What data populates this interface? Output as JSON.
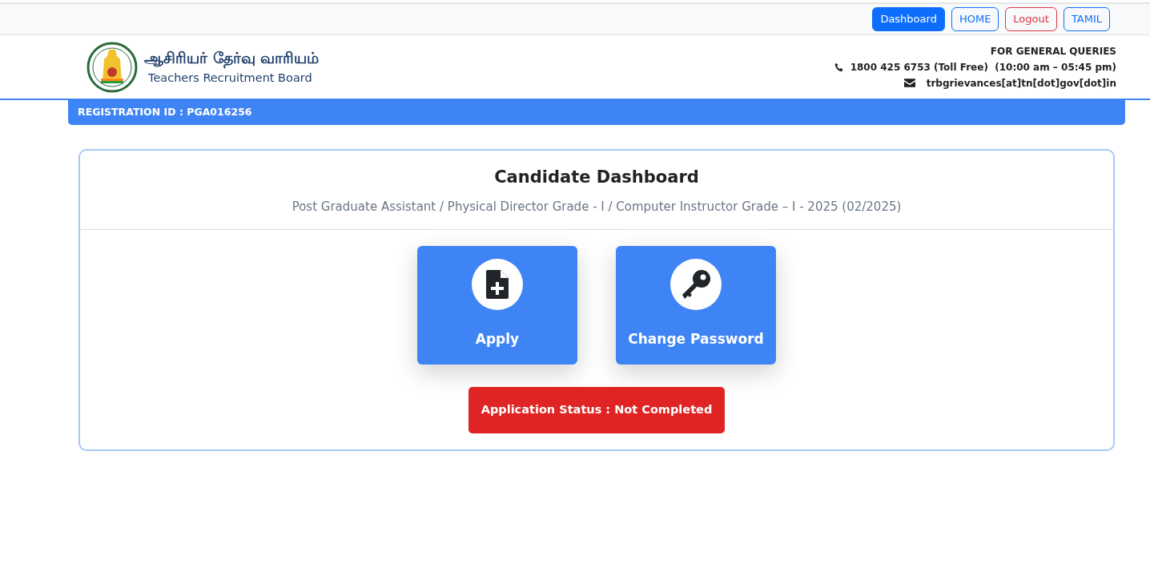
{
  "nav_buttons": [
    {
      "label": "Dashboard",
      "kind": "link",
      "selected": true
    },
    {
      "label": "HOME",
      "kind": "link",
      "selected": false
    },
    {
      "label": "Logout",
      "kind": "logout",
      "selected": false
    },
    {
      "label": "TAMIL",
      "kind": "link",
      "selected": false
    }
  ],
  "header": {
    "title_tamil": "ஆசிரியர் தேர்வு வாரியம்",
    "title_english": "Teachers Recruitment Board",
    "contact_heading": "FOR GENERAL QUERIES",
    "phone": "1800 425 6753 (Toll Free)  (10:00 am – 05:45 pm)",
    "email": "trbgrievances[at]tn[dot]gov[dot]in"
  },
  "registration_id": "REGISTRATION ID : PGA016256",
  "dashboard": {
    "title": "Candidate Dashboard",
    "subtitle": "Post Graduate Assistant / Physical Director Grade - I / Computer Instructor Grade – I - 2025 (02/2025)",
    "tiles": [
      {
        "kind": "apply",
        "label": "Apply"
      },
      {
        "kind": "password",
        "label": "Change Password"
      }
    ],
    "status": "Application Status : Not Completed"
  }
}
